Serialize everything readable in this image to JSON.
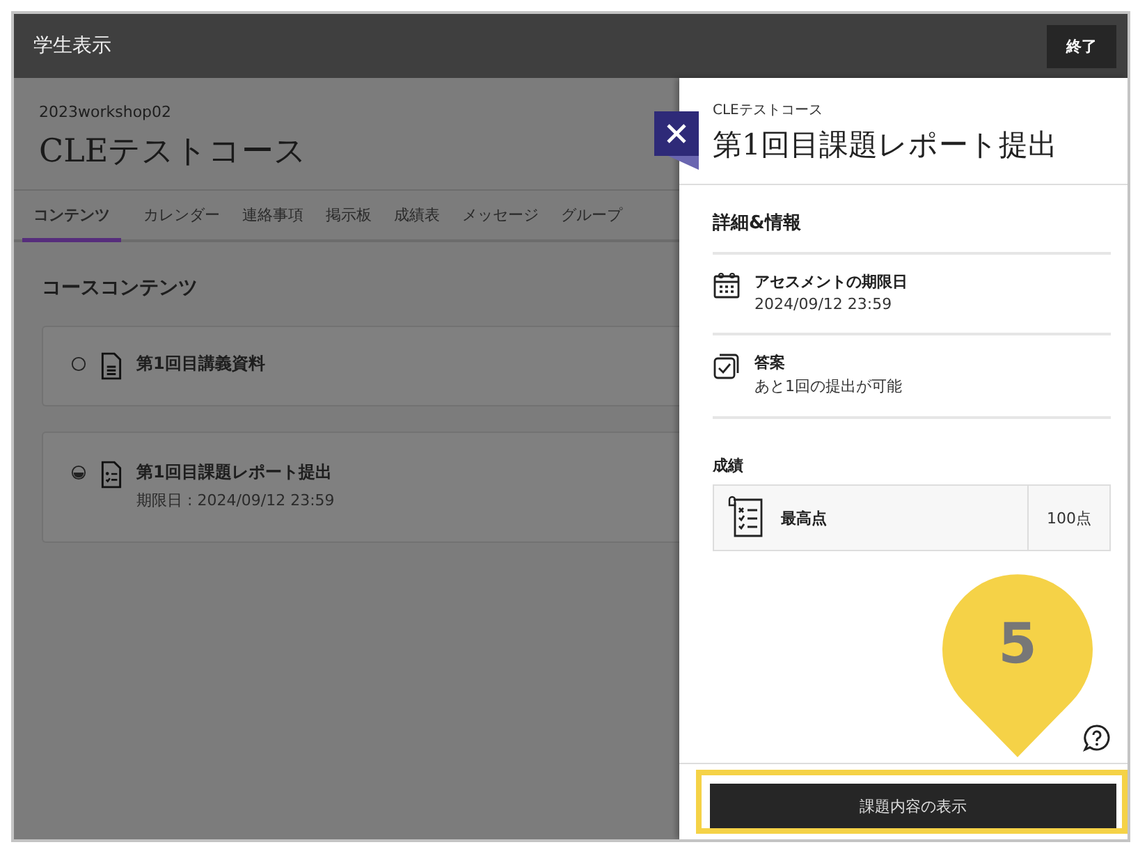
{
  "top_bar": {
    "title": "学生表示",
    "exit_button": "終了"
  },
  "course": {
    "code": "2023workshop02",
    "title": "CLEテストコース"
  },
  "tabs": [
    {
      "label": "コンテンツ",
      "selected": true
    },
    {
      "label": "カレンダー",
      "selected": false
    },
    {
      "label": "連絡事項",
      "selected": false
    },
    {
      "label": "掲示板",
      "selected": false
    },
    {
      "label": "成績表",
      "selected": false
    },
    {
      "label": "メッセージ",
      "selected": false
    },
    {
      "label": "グループ",
      "selected": false
    }
  ],
  "contents": {
    "heading": "コースコンテンツ",
    "items": [
      {
        "title": "第1回目講義資料",
        "kind": "document",
        "in_progress": false
      },
      {
        "title": "第1回目課題レポート提出",
        "kind": "assignment",
        "in_progress": true,
        "due": "期限日 : 2024/09/12 23:59"
      }
    ]
  },
  "panel": {
    "course": "CLEテストコース",
    "title": "第1回目課題レポート提出",
    "section": "詳細&情報",
    "details": [
      {
        "kind": "calendar",
        "label": "アセスメントの期限日",
        "value": "2024/09/12 23:59"
      },
      {
        "kind": "submission",
        "label": "答案",
        "value": "あと1回の提出が可能"
      }
    ],
    "grade": {
      "heading": "成績",
      "label": "最高点",
      "value": "100点"
    },
    "action_button": "課題内容の表示"
  },
  "callout": {
    "number": "5"
  }
}
